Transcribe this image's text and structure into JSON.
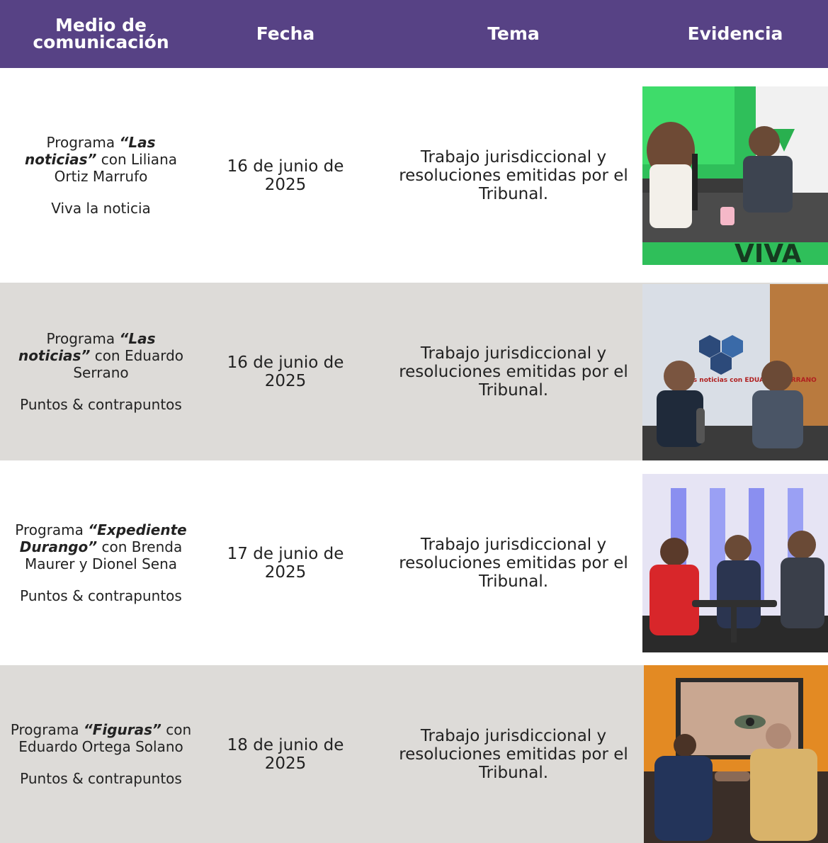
{
  "headers": {
    "medio": "Medio de comunicación",
    "fecha": "Fecha",
    "tema": "Tema",
    "evidencia": "Evidencia"
  },
  "rows": [
    {
      "programa_prefix": "Programa ",
      "programa_title": "“Las noticias”",
      "programa_suffix": " con Liliana Ortiz Marrufo",
      "medio": "Viva la noticia",
      "fecha": "16 de junio de 2025",
      "tema": "Trabajo jurisdiccional y resoluciones emitidas por el Tribunal.",
      "evidencia": "set-viva-la-noticia-photo",
      "photo_text": "VIVA"
    },
    {
      "programa_prefix": "Programa ",
      "programa_title": "“Las noticias”",
      "programa_suffix": " con Eduardo Serrano",
      "medio": "Puntos & contrapuntos",
      "fecha": "16 de junio de 2025",
      "tema": "Trabajo jurisdiccional y resoluciones emitidas por el Tribunal.",
      "evidencia": "set-puntos-contrapuntos-photo",
      "photo_text": "Las noticias con EDUARDO SERRANO"
    },
    {
      "programa_prefix": "Programa ",
      "programa_title": "“Expediente Durango”",
      "programa_suffix": " con Brenda Maurer y Dionel Sena",
      "medio": "Puntos & contrapuntos",
      "fecha": "17 de junio de 2025",
      "tema": "Trabajo jurisdiccional y resoluciones emitidas por el Tribunal.",
      "evidencia": "set-expediente-durango-photo",
      "photo_text": ""
    },
    {
      "programa_prefix": "Programa ",
      "programa_title": "“Figuras”",
      "programa_suffix": " con Eduardo Ortega Solano",
      "medio": "Puntos & contrapuntos",
      "fecha": "18 de junio de 2025",
      "tema": "Trabajo jurisdiccional y resoluciones emitidas por el Tribunal.",
      "evidencia": "set-figuras-photo",
      "photo_text": ""
    }
  ],
  "colors": {
    "header_bg": "#574285",
    "row_shade": "#dddbd8"
  }
}
